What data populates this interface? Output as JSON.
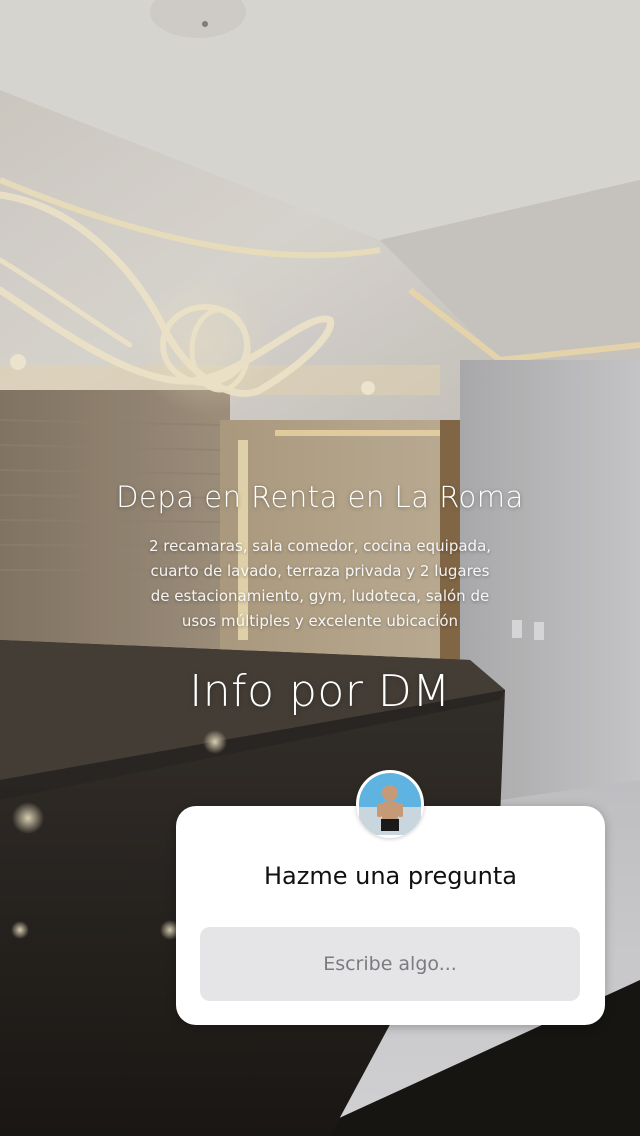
{
  "story": {
    "headline": "Depa en Renta en La Roma",
    "description": "2 recamaras, sala comedor, cocina equipada, cuarto de lavado, terraza privada y 2 lugares de estacionamiento, gym, ludoteca, salón de usos múltiples y excelente ubicación",
    "cta": "Info por DM"
  },
  "question_sticker": {
    "title": "Hazme una pregunta",
    "input_placeholder": "Escribe algo...",
    "avatar": "profile-avatar"
  },
  "colors": {
    "sticker_bg": "#ffffff",
    "input_bg": "#e5e5e8",
    "led_light": "#ffe6b0"
  }
}
